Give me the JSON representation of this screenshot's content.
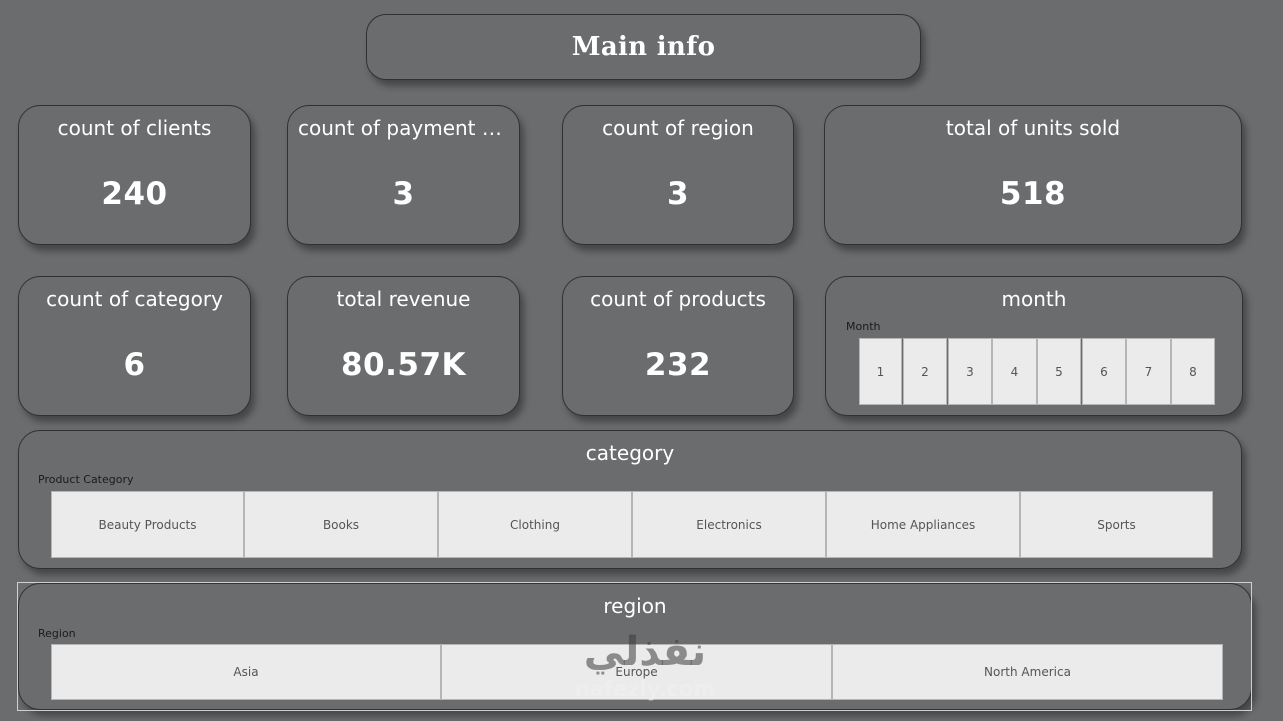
{
  "header": {
    "title": "Main info"
  },
  "kpis": {
    "clients": {
      "label": "count of clients",
      "value": "240"
    },
    "payment_methods": {
      "label": "count of payment m...",
      "value": "3"
    },
    "region": {
      "label": "count of region",
      "value": "3"
    },
    "units_sold": {
      "label": "total of units sold",
      "value": "518"
    },
    "category": {
      "label": "count of category",
      "value": "6"
    },
    "revenue": {
      "label": "total revenue",
      "value": "80.57K"
    },
    "products": {
      "label": "count of products",
      "value": "232"
    }
  },
  "month_slicer": {
    "title": "month",
    "field_label": "Month",
    "options": [
      "1",
      "2",
      "3",
      "4",
      "5",
      "6",
      "7",
      "8"
    ]
  },
  "category_slicer": {
    "title": "category",
    "field_label": "Product Category",
    "options": [
      "Beauty Products",
      "Books",
      "Clothing",
      "Electronics",
      "Home Appliances",
      "Sports"
    ]
  },
  "region_slicer": {
    "title": "region",
    "field_label": "Region",
    "options": [
      "Asia",
      "Europe",
      "North America"
    ]
  },
  "watermark": {
    "arabic": "نفذلي",
    "latin": "nafezly.com"
  },
  "colors": {
    "background": "#6a6c6e",
    "card_border": "#2f3133",
    "tile_background": "#ebebeb",
    "text": "#ffffff"
  }
}
